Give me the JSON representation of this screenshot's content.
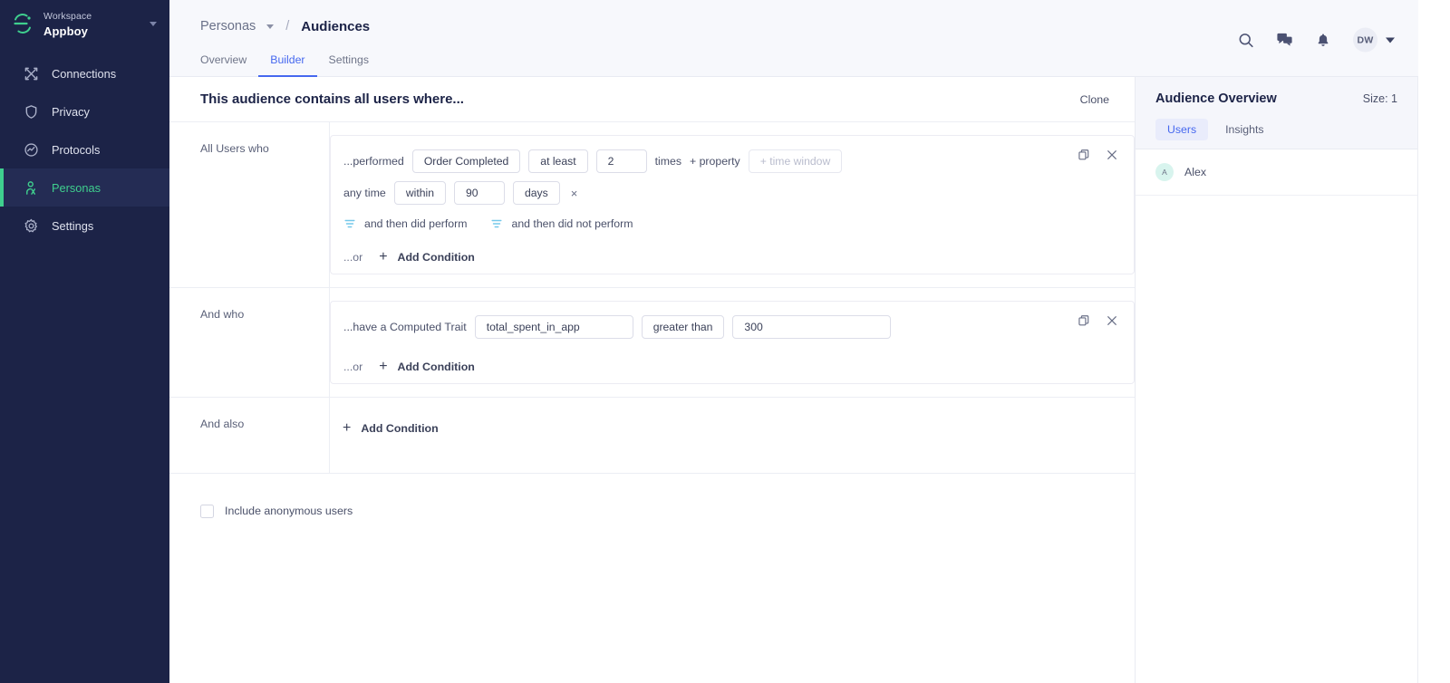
{
  "sidebar": {
    "workspace_label": "Workspace",
    "workspace_name": "Appboy",
    "items": [
      {
        "label": "Connections",
        "icon": "connections-icon",
        "active": false
      },
      {
        "label": "Privacy",
        "icon": "shield-icon",
        "active": false
      },
      {
        "label": "Protocols",
        "icon": "protocols-icon",
        "active": false
      },
      {
        "label": "Personas",
        "icon": "persona-icon",
        "active": true
      },
      {
        "label": "Settings",
        "icon": "gear-icon",
        "active": false
      }
    ]
  },
  "header": {
    "breadcrumb_parent": "Personas",
    "breadcrumb_separator": "/",
    "breadcrumb_current": "Audiences",
    "avatar_initials": "DW",
    "tabs": [
      {
        "label": "Overview",
        "active": false
      },
      {
        "label": "Builder",
        "active": true
      },
      {
        "label": "Settings",
        "active": false
      }
    ]
  },
  "builder": {
    "title": "This audience contains all users where...",
    "clone_label": "Clone",
    "groups": [
      {
        "label": "All Users who",
        "prefix": "...performed",
        "event": "Order Completed",
        "operator": "at least",
        "count": "2",
        "times_label": "times",
        "property_label": "+ property",
        "time_window_placeholder": "+ time window",
        "second_prefix": "any time",
        "within": "within",
        "duration": "90",
        "unit": "days",
        "remove_mark": "×",
        "then_perform": "and then did perform",
        "then_not_perform": "and then did not perform",
        "or_label": "...or",
        "add_condition": "Add Condition"
      },
      {
        "label": "And who",
        "prefix": "...have a Computed Trait",
        "trait": "total_spent_in_app",
        "comparator": "greater than",
        "value": "300",
        "or_label": "...or",
        "add_condition": "Add Condition"
      },
      {
        "label": "And also",
        "add_condition": "Add Condition"
      }
    ],
    "include_anonymous_label": "Include anonymous users"
  },
  "overview": {
    "title": "Audience Overview",
    "size_label": "Size: 1",
    "tabs": [
      {
        "label": "Users",
        "active": true
      },
      {
        "label": "Insights",
        "active": false
      }
    ],
    "users": [
      {
        "initial": "A",
        "name": "Alex"
      }
    ]
  },
  "colors": {
    "sidebar_bg": "#1c2347",
    "accent_green": "#3fcf8e",
    "accent_blue": "#4668ef",
    "filter_icon": "#74c8ea"
  }
}
